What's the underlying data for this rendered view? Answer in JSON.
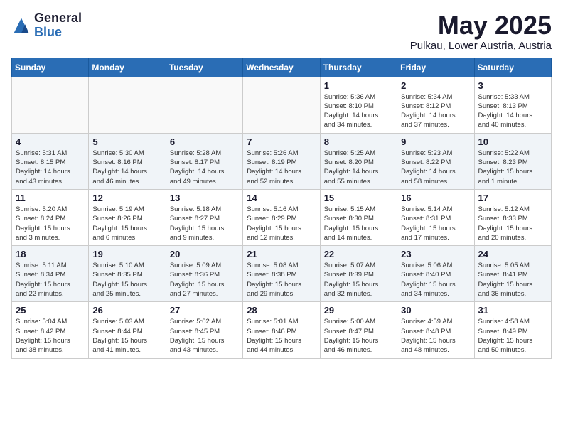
{
  "logo": {
    "general": "General",
    "blue": "Blue"
  },
  "title": {
    "month": "May 2025",
    "location": "Pulkau, Lower Austria, Austria"
  },
  "weekdays": [
    "Sunday",
    "Monday",
    "Tuesday",
    "Wednesday",
    "Thursday",
    "Friday",
    "Saturday"
  ],
  "weeks": [
    [
      {
        "day": "",
        "detail": ""
      },
      {
        "day": "",
        "detail": ""
      },
      {
        "day": "",
        "detail": ""
      },
      {
        "day": "",
        "detail": ""
      },
      {
        "day": "1",
        "detail": "Sunrise: 5:36 AM\nSunset: 8:10 PM\nDaylight: 14 hours\nand 34 minutes."
      },
      {
        "day": "2",
        "detail": "Sunrise: 5:34 AM\nSunset: 8:12 PM\nDaylight: 14 hours\nand 37 minutes."
      },
      {
        "day": "3",
        "detail": "Sunrise: 5:33 AM\nSunset: 8:13 PM\nDaylight: 14 hours\nand 40 minutes."
      }
    ],
    [
      {
        "day": "4",
        "detail": "Sunrise: 5:31 AM\nSunset: 8:15 PM\nDaylight: 14 hours\nand 43 minutes."
      },
      {
        "day": "5",
        "detail": "Sunrise: 5:30 AM\nSunset: 8:16 PM\nDaylight: 14 hours\nand 46 minutes."
      },
      {
        "day": "6",
        "detail": "Sunrise: 5:28 AM\nSunset: 8:17 PM\nDaylight: 14 hours\nand 49 minutes."
      },
      {
        "day": "7",
        "detail": "Sunrise: 5:26 AM\nSunset: 8:19 PM\nDaylight: 14 hours\nand 52 minutes."
      },
      {
        "day": "8",
        "detail": "Sunrise: 5:25 AM\nSunset: 8:20 PM\nDaylight: 14 hours\nand 55 minutes."
      },
      {
        "day": "9",
        "detail": "Sunrise: 5:23 AM\nSunset: 8:22 PM\nDaylight: 14 hours\nand 58 minutes."
      },
      {
        "day": "10",
        "detail": "Sunrise: 5:22 AM\nSunset: 8:23 PM\nDaylight: 15 hours\nand 1 minute."
      }
    ],
    [
      {
        "day": "11",
        "detail": "Sunrise: 5:20 AM\nSunset: 8:24 PM\nDaylight: 15 hours\nand 3 minutes."
      },
      {
        "day": "12",
        "detail": "Sunrise: 5:19 AM\nSunset: 8:26 PM\nDaylight: 15 hours\nand 6 minutes."
      },
      {
        "day": "13",
        "detail": "Sunrise: 5:18 AM\nSunset: 8:27 PM\nDaylight: 15 hours\nand 9 minutes."
      },
      {
        "day": "14",
        "detail": "Sunrise: 5:16 AM\nSunset: 8:29 PM\nDaylight: 15 hours\nand 12 minutes."
      },
      {
        "day": "15",
        "detail": "Sunrise: 5:15 AM\nSunset: 8:30 PM\nDaylight: 15 hours\nand 14 minutes."
      },
      {
        "day": "16",
        "detail": "Sunrise: 5:14 AM\nSunset: 8:31 PM\nDaylight: 15 hours\nand 17 minutes."
      },
      {
        "day": "17",
        "detail": "Sunrise: 5:12 AM\nSunset: 8:33 PM\nDaylight: 15 hours\nand 20 minutes."
      }
    ],
    [
      {
        "day": "18",
        "detail": "Sunrise: 5:11 AM\nSunset: 8:34 PM\nDaylight: 15 hours\nand 22 minutes."
      },
      {
        "day": "19",
        "detail": "Sunrise: 5:10 AM\nSunset: 8:35 PM\nDaylight: 15 hours\nand 25 minutes."
      },
      {
        "day": "20",
        "detail": "Sunrise: 5:09 AM\nSunset: 8:36 PM\nDaylight: 15 hours\nand 27 minutes."
      },
      {
        "day": "21",
        "detail": "Sunrise: 5:08 AM\nSunset: 8:38 PM\nDaylight: 15 hours\nand 29 minutes."
      },
      {
        "day": "22",
        "detail": "Sunrise: 5:07 AM\nSunset: 8:39 PM\nDaylight: 15 hours\nand 32 minutes."
      },
      {
        "day": "23",
        "detail": "Sunrise: 5:06 AM\nSunset: 8:40 PM\nDaylight: 15 hours\nand 34 minutes."
      },
      {
        "day": "24",
        "detail": "Sunrise: 5:05 AM\nSunset: 8:41 PM\nDaylight: 15 hours\nand 36 minutes."
      }
    ],
    [
      {
        "day": "25",
        "detail": "Sunrise: 5:04 AM\nSunset: 8:42 PM\nDaylight: 15 hours\nand 38 minutes."
      },
      {
        "day": "26",
        "detail": "Sunrise: 5:03 AM\nSunset: 8:44 PM\nDaylight: 15 hours\nand 41 minutes."
      },
      {
        "day": "27",
        "detail": "Sunrise: 5:02 AM\nSunset: 8:45 PM\nDaylight: 15 hours\nand 43 minutes."
      },
      {
        "day": "28",
        "detail": "Sunrise: 5:01 AM\nSunset: 8:46 PM\nDaylight: 15 hours\nand 44 minutes."
      },
      {
        "day": "29",
        "detail": "Sunrise: 5:00 AM\nSunset: 8:47 PM\nDaylight: 15 hours\nand 46 minutes."
      },
      {
        "day": "30",
        "detail": "Sunrise: 4:59 AM\nSunset: 8:48 PM\nDaylight: 15 hours\nand 48 minutes."
      },
      {
        "day": "31",
        "detail": "Sunrise: 4:58 AM\nSunset: 8:49 PM\nDaylight: 15 hours\nand 50 minutes."
      }
    ]
  ]
}
